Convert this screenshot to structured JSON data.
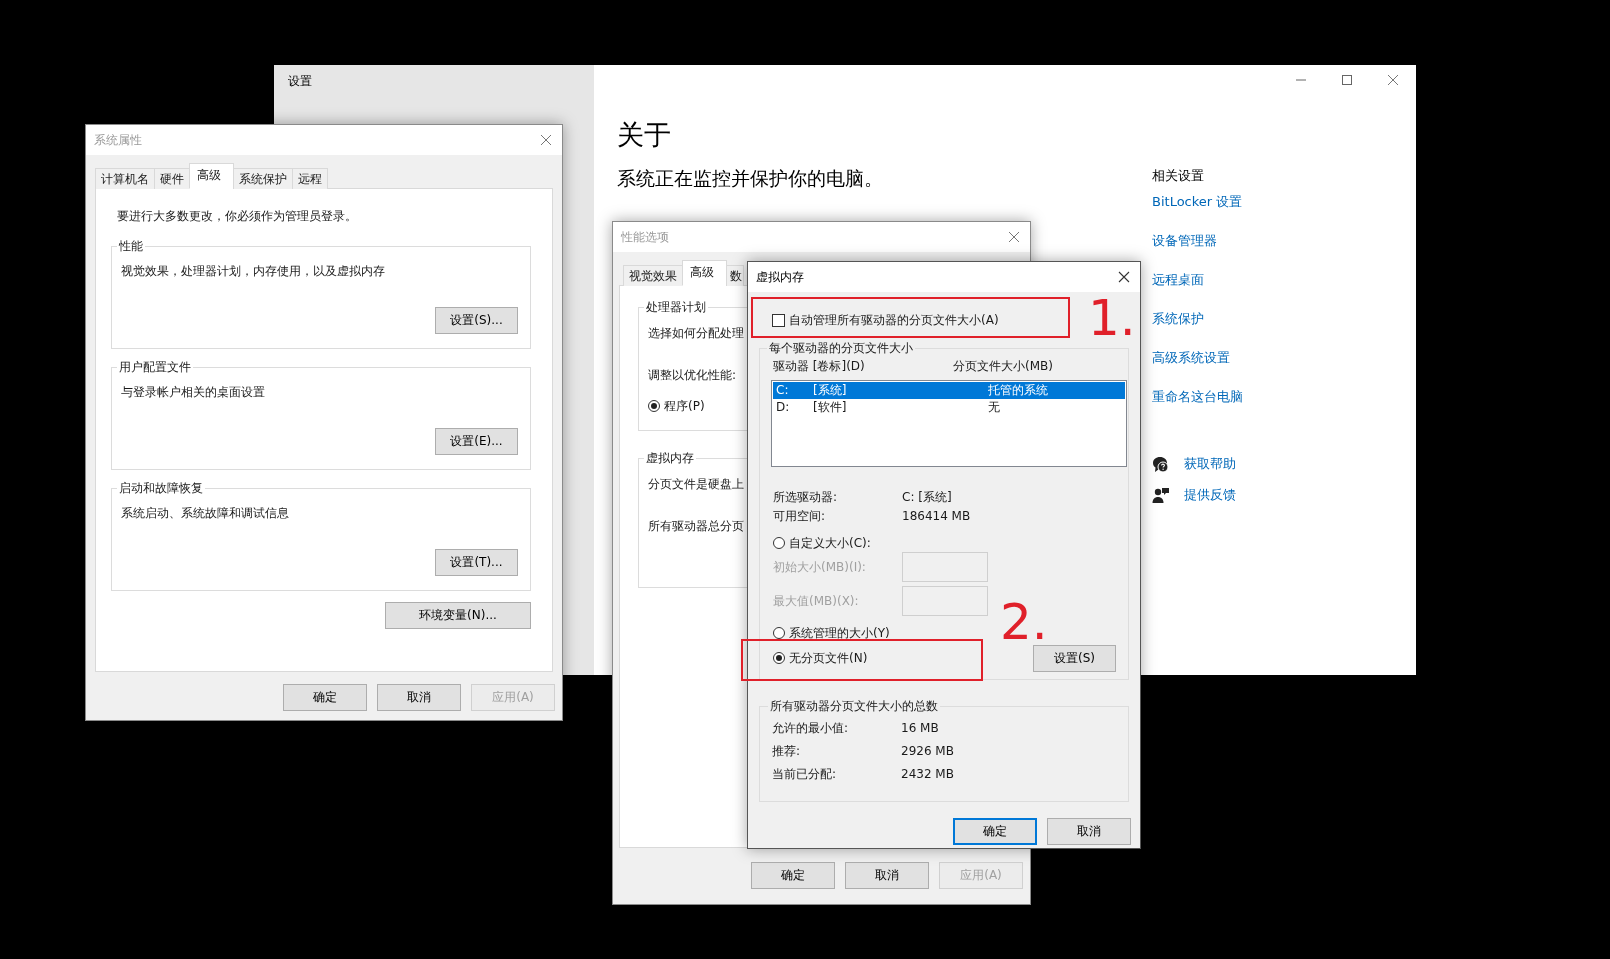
{
  "settings_window": {
    "title": "设置",
    "heading": "关于",
    "status": "系统正在监控并保护你的电脑。",
    "related_title": "相关设置",
    "related_links": [
      "BitLocker 设置",
      "设备管理器",
      "远程桌面",
      "系统保护",
      "高级系统设置",
      "重命名这台电脑"
    ],
    "help_links": [
      {
        "label": "获取帮助",
        "kind": "help"
      },
      {
        "label": "提供反馈",
        "kind": "feedback"
      }
    ]
  },
  "system_properties": {
    "title": "系统属性",
    "tabs": [
      {
        "label": "计算机名",
        "selected": false
      },
      {
        "label": "硬件",
        "selected": false
      },
      {
        "label": "高级",
        "selected": true
      },
      {
        "label": "系统保护",
        "selected": false
      },
      {
        "label": "远程",
        "selected": false
      }
    ],
    "notice": "要进行大多数更改，你必须作为管理员登录。",
    "groups": [
      {
        "title": "性能",
        "description": "视觉效果，处理器计划，内存使用，以及虚拟内存",
        "button": "设置(S)..."
      },
      {
        "title": "用户配置文件",
        "description": "与登录帐户相关的桌面设置",
        "button": "设置(E)..."
      },
      {
        "title": "启动和故障恢复",
        "description": "系统启动、系统故障和调试信息",
        "button": "设置(T)..."
      }
    ],
    "env_button": "环境变量(N)...",
    "buttons": [
      {
        "label": "确定",
        "disabled": false
      },
      {
        "label": "取消",
        "disabled": false
      },
      {
        "label": "应用(A)",
        "disabled": true
      }
    ]
  },
  "performance_options": {
    "title": "性能选项",
    "tabs": [
      {
        "label": "视觉效果",
        "selected": false
      },
      {
        "label": "高级",
        "selected": true
      },
      {
        "label": "数",
        "selected": false
      }
    ],
    "groups": [
      {
        "title": "处理器计划",
        "lines": [
          "选择如何分配处理",
          "调整以优化性能:"
        ],
        "radio": {
          "label": "程序(P)",
          "selected": true
        }
      },
      {
        "title": "虚拟内存",
        "lines": [
          "分页文件是硬盘上",
          "所有驱动器总分页"
        ]
      }
    ],
    "buttons": [
      {
        "label": "确定",
        "disabled": false
      },
      {
        "label": "取消",
        "disabled": false
      },
      {
        "label": "应用(A)",
        "disabled": true
      }
    ]
  },
  "virtual_memory": {
    "title": "虚拟内存",
    "auto_manage": {
      "label": "自动管理所有驱动器的分页文件大小(A)",
      "checked": false
    },
    "drives_group": {
      "title": "每个驱动器的分页文件大小",
      "columns": [
        "驱动器 [卷标](D)",
        "分页文件大小(MB)"
      ],
      "rows": [
        {
          "drive": "C:",
          "label": "[系统]",
          "size": "托管的系统",
          "selected": true
        },
        {
          "drive": "D:",
          "label": "[软件]",
          "size": "无",
          "selected": false
        }
      ],
      "info": [
        {
          "label": "所选驱动器:",
          "value": "C:  [系统]"
        },
        {
          "label": "可用空间:",
          "value": "186414 MB"
        }
      ],
      "options": [
        {
          "kind": "radio",
          "label": "自定义大小(C):",
          "selected": false
        },
        {
          "kind": "field",
          "label": "初始大小(MB)(I):",
          "disabled": true
        },
        {
          "kind": "field",
          "label": "最大值(MB)(X):",
          "disabled": true
        },
        {
          "kind": "radio",
          "label": "系统管理的大小(Y)",
          "selected": false
        },
        {
          "kind": "radio",
          "label": "无分页文件(N)",
          "selected": true
        }
      ],
      "set_button": "设置(S)"
    },
    "totals": {
      "title": "所有驱动器分页文件大小的总数",
      "rows": [
        {
          "label": "允许的最小值:",
          "value": "16 MB"
        },
        {
          "label": "推荐:",
          "value": "2926 MB"
        },
        {
          "label": "当前已分配:",
          "value": "2432 MB"
        }
      ]
    },
    "buttons": [
      {
        "label": "确定",
        "default": true
      },
      {
        "label": "取消",
        "default": false
      }
    ]
  },
  "annotations": [
    {
      "label": "1."
    },
    {
      "label": "2."
    }
  ]
}
